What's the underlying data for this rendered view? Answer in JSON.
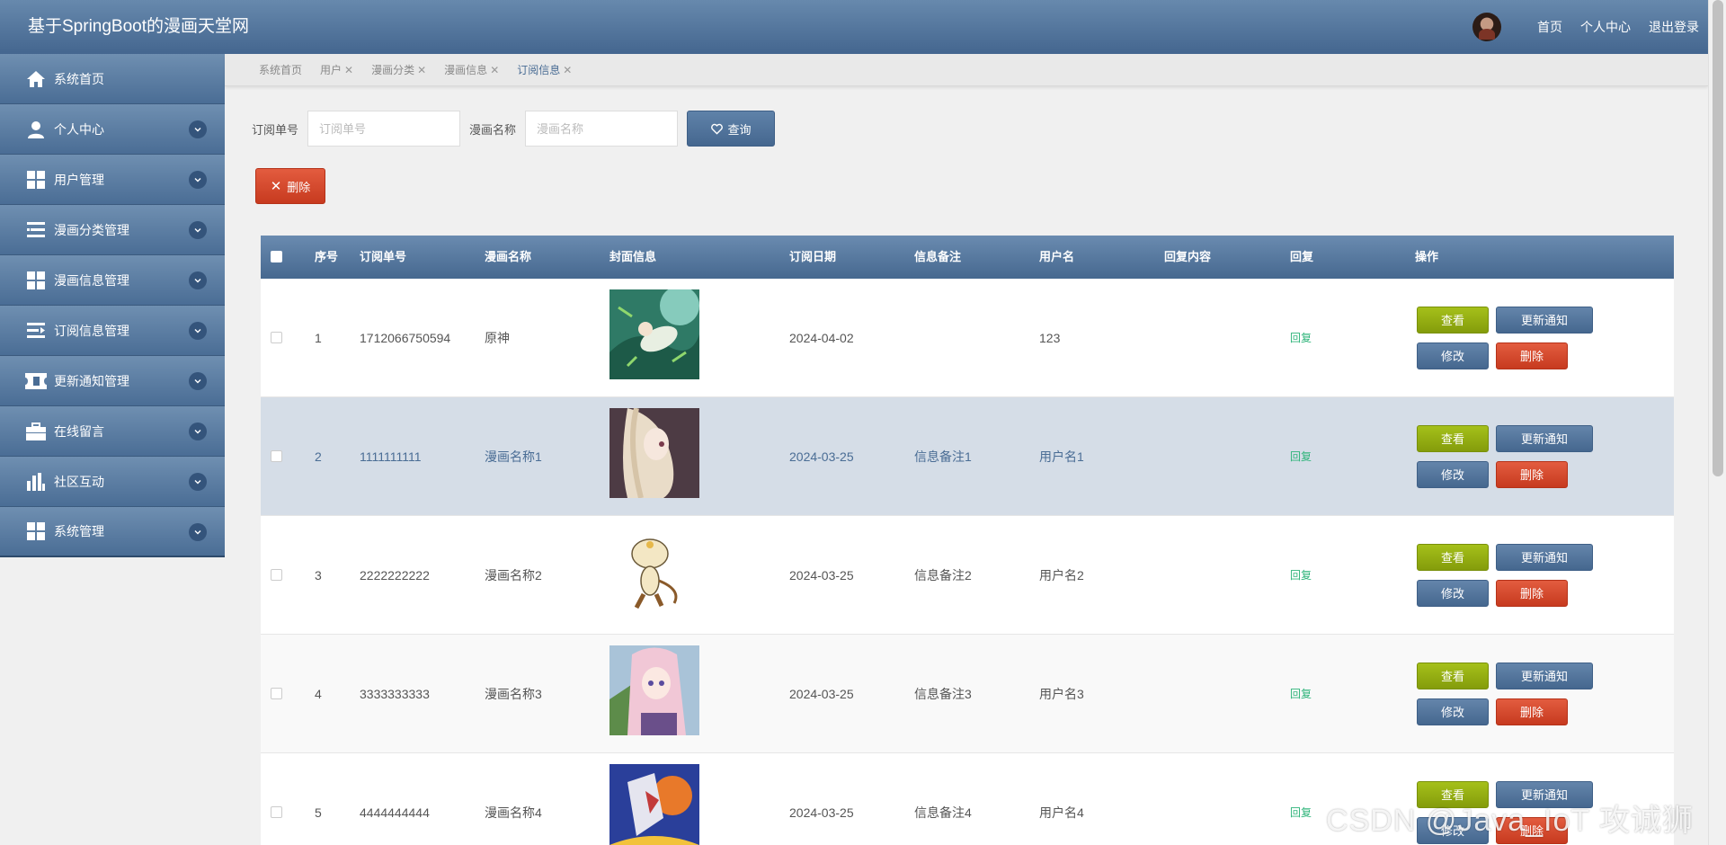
{
  "header": {
    "title": "基于SpringBoot的漫画天堂网",
    "links": [
      "首页",
      "个人中心",
      "退出登录"
    ]
  },
  "sidebar": {
    "items": [
      {
        "label": "系统首页",
        "icon": "home-icon"
      },
      {
        "label": "个人中心",
        "icon": "user-icon"
      },
      {
        "label": "用户管理",
        "icon": "grid-icon"
      },
      {
        "label": "漫画分类管理",
        "icon": "list-icon"
      },
      {
        "label": "漫画信息管理",
        "icon": "grid-icon"
      },
      {
        "label": "订阅信息管理",
        "icon": "list-indent-icon"
      },
      {
        "label": "更新通知管理",
        "icon": "ticket-icon"
      },
      {
        "label": "在线留言",
        "icon": "briefcase-icon"
      },
      {
        "label": "社区互动",
        "icon": "bar-chart-icon"
      },
      {
        "label": "系统管理",
        "icon": "grid-icon"
      }
    ]
  },
  "tabs": [
    "系统首页",
    "用户",
    "漫画分类",
    "漫画信息",
    "订阅信息"
  ],
  "search": {
    "order_label": "订阅单号",
    "order_placeholder": "订阅单号",
    "name_label": "漫画名称",
    "name_placeholder": "漫画名称",
    "query_label": "查询"
  },
  "toolbar": {
    "delete_label": "删除"
  },
  "table": {
    "headers": [
      "序号",
      "订阅单号",
      "漫画名称",
      "封面信息",
      "订阅日期",
      "信息备注",
      "用户名",
      "回复内容",
      "回复",
      "操作"
    ],
    "rows": [
      {
        "index": "1",
        "order": "1712066750594",
        "name": "原神",
        "date": "2024-04-02",
        "note": "",
        "user": "123",
        "reply_content": ""
      },
      {
        "index": "2",
        "order": "1111111111",
        "name": "漫画名称1",
        "date": "2024-03-25",
        "note": "信息备注1",
        "user": "用户名1",
        "reply_content": ""
      },
      {
        "index": "3",
        "order": "2222222222",
        "name": "漫画名称2",
        "date": "2024-03-25",
        "note": "信息备注2",
        "user": "用户名2",
        "reply_content": ""
      },
      {
        "index": "4",
        "order": "3333333333",
        "name": "漫画名称3",
        "date": "2024-03-25",
        "note": "信息备注3",
        "user": "用户名3",
        "reply_content": ""
      },
      {
        "index": "5",
        "order": "4444444444",
        "name": "漫画名称4",
        "date": "2024-03-25",
        "note": "信息备注4",
        "user": "用户名4",
        "reply_content": ""
      }
    ],
    "reply_link": "回复",
    "actions": {
      "view": "查看",
      "notify": "更新通知",
      "edit": "修改",
      "delete": "删除"
    }
  },
  "watermark": "CSDN @Java_IoT 攻诚狮",
  "colors": {
    "primary": "#4a6d95",
    "view_button": "#9bb516",
    "danger": "#d4452a",
    "reply": "#2fb47a"
  }
}
